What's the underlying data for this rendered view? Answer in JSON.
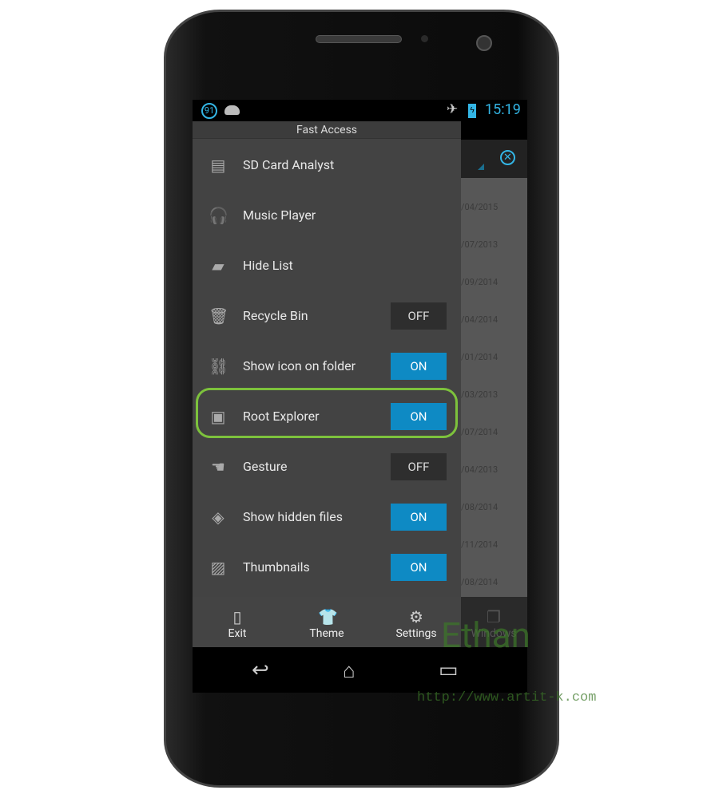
{
  "status": {
    "badge": "91",
    "time": "15:19"
  },
  "drawer": {
    "title": "Fast Access",
    "items": [
      {
        "label": "SD Card Analyst",
        "icon": "sd-card-icon"
      },
      {
        "label": "Music Player",
        "icon": "headphones-icon"
      },
      {
        "label": "Hide List",
        "icon": "locked-folder-icon"
      },
      {
        "label": "Recycle Bin",
        "icon": "trash-icon",
        "toggle": "OFF"
      },
      {
        "label": "Show icon on folder",
        "icon": "link-icon",
        "toggle": "ON"
      },
      {
        "label": "Root Explorer",
        "icon": "root-explorer-icon",
        "toggle": "ON",
        "highlighted": true
      },
      {
        "label": "Gesture",
        "icon": "hand-icon",
        "toggle": "OFF"
      },
      {
        "label": "Show hidden files",
        "icon": "hidden-file-icon",
        "toggle": "ON"
      },
      {
        "label": "Thumbnails",
        "icon": "image-icon",
        "toggle": "ON"
      }
    ]
  },
  "background_list": {
    "dates": [
      "/04/2015",
      "/07/2013",
      "/09/2014",
      "/04/2014",
      "/01/2014",
      "/03/2013",
      "/07/2014",
      "/04/2013",
      "/08/2014",
      "/11/2014",
      "/08/2014"
    ]
  },
  "bottom_bar": {
    "exit": "Exit",
    "theme": "Theme",
    "settings": "Settings",
    "windows": "Windows"
  },
  "watermark": {
    "name": "Ethan",
    "url": "http://www.artit-k.com"
  },
  "colors": {
    "accent": "#33b5e5",
    "toggle_on": "#0e8ac4",
    "highlight": "#7dc23c"
  }
}
